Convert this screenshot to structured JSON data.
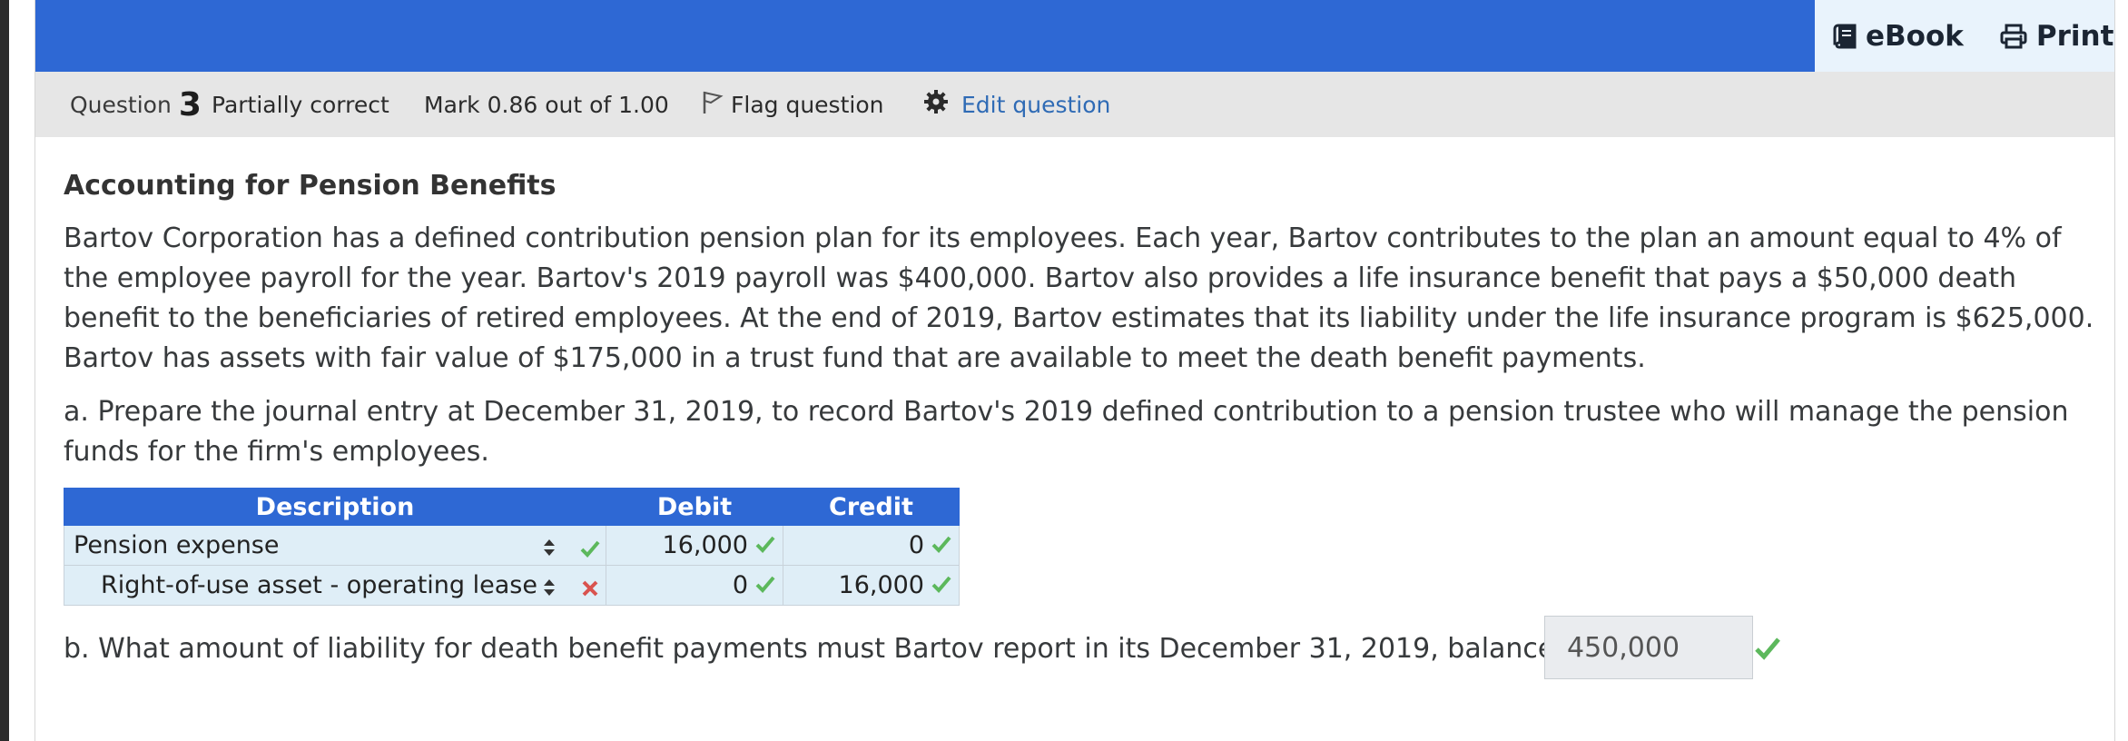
{
  "toolbar": {
    "ebook_label": "eBook",
    "print_label": "Print",
    "ebook_icon": "book-icon",
    "print_icon": "printer-icon"
  },
  "question_header": {
    "question_label": "Question",
    "question_number": "3",
    "status": "Partially correct",
    "mark": "Mark 0.86 out of 1.00",
    "flag_label": "Flag question",
    "edit_label": "Edit question"
  },
  "question": {
    "title": "Accounting for Pension Benefits",
    "paragraph": "Bartov Corporation has a defined contribution pension plan for its employees. Each year, Bartov contributes to the plan an amount equal to 4% of the employee payroll for the year. Bartov's 2019 payroll was $400,000. Bartov also provides a life insurance benefit that pays a $50,000 death benefit to the beneficiaries of retired employees. At the end of 2019, Bartov estimates that its liability under the life insurance program is $625,000. Bartov has assets with fair value of $175,000 in a trust fund that are available to meet the death benefit payments.",
    "part_a": "a. Prepare the journal entry at December 31, 2019, to record Bartov's 2019 defined contribution to a pension trustee who will manage the pension funds for the firm's employees.",
    "part_b": "b. What amount of liability for death benefit payments must Bartov report in its December 31, 2019, balance sheet? $",
    "part_b_answer": "450,000"
  },
  "journal_table": {
    "headers": [
      "Description",
      "Debit",
      "Credit"
    ],
    "rows": [
      {
        "description": "Pension expense",
        "desc_mark": "correct",
        "debit": "16,000",
        "debit_mark": "correct",
        "credit": "0",
        "credit_mark": "correct"
      },
      {
        "description": "Right-of-use asset - operating lease",
        "desc_mark": "incorrect",
        "debit": "0",
        "debit_mark": "correct",
        "credit": "16,000",
        "credit_mark": "correct"
      }
    ]
  },
  "colors": {
    "header_blue": "#2e68d4",
    "correct_green": "#5cb85c",
    "incorrect_red": "#d9534f",
    "header_gray": "#e6e6e6"
  }
}
